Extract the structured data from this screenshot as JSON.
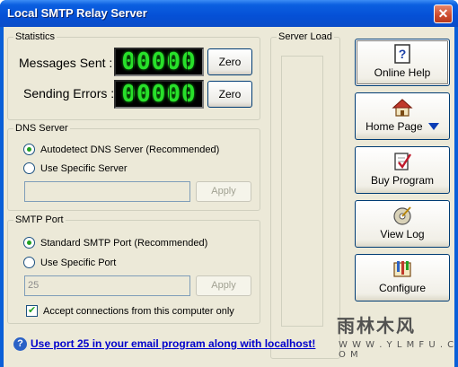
{
  "window": {
    "title": "Local SMTP Relay Server",
    "close_glyph": "✕",
    "title_gradient_color": "#0550d6"
  },
  "statistics": {
    "legend": "Statistics",
    "messages_sent_label": "Messages Sent :",
    "messages_sent_value": "00000",
    "sending_errors_label": "Sending Errors :",
    "sending_errors_value": "00000",
    "zero_label": "Zero",
    "counter_color": "#28e02a"
  },
  "dns": {
    "legend": "DNS Server",
    "option_auto": "Autodetect DNS Server (Recommended)",
    "option_specific": "Use Specific Server",
    "auto_selected": true,
    "server_value": "",
    "apply_label": "Apply"
  },
  "smtp_port": {
    "legend": "SMTP Port",
    "option_standard": "Standard SMTP Port (Recommended)",
    "option_specific": "Use Specific Port",
    "standard_selected": true,
    "port_value": "25",
    "apply_label": "Apply",
    "accept_local_label": "Accept connections from this computer only",
    "accept_local_checked": true
  },
  "server_load": {
    "legend": "Server Load"
  },
  "sidebar": {
    "buttons": [
      {
        "label": "Online Help",
        "icon": "help-book-icon"
      },
      {
        "label": "Home Page",
        "icon": "home-icon",
        "has_dropdown": true
      },
      {
        "label": "Buy Program",
        "icon": "checkmark-document-icon"
      },
      {
        "label": "View Log",
        "icon": "log-disk-icon"
      },
      {
        "label": "Configure",
        "icon": "configure-icon"
      }
    ]
  },
  "footer": {
    "help_icon_glyph": "?",
    "link_text": "Use port 25 in your email program along with localhost!",
    "link_color": "#0000cc"
  },
  "watermark": {
    "text_main": "雨林木风",
    "text_url": "W W W . Y L M F U . C O M"
  }
}
